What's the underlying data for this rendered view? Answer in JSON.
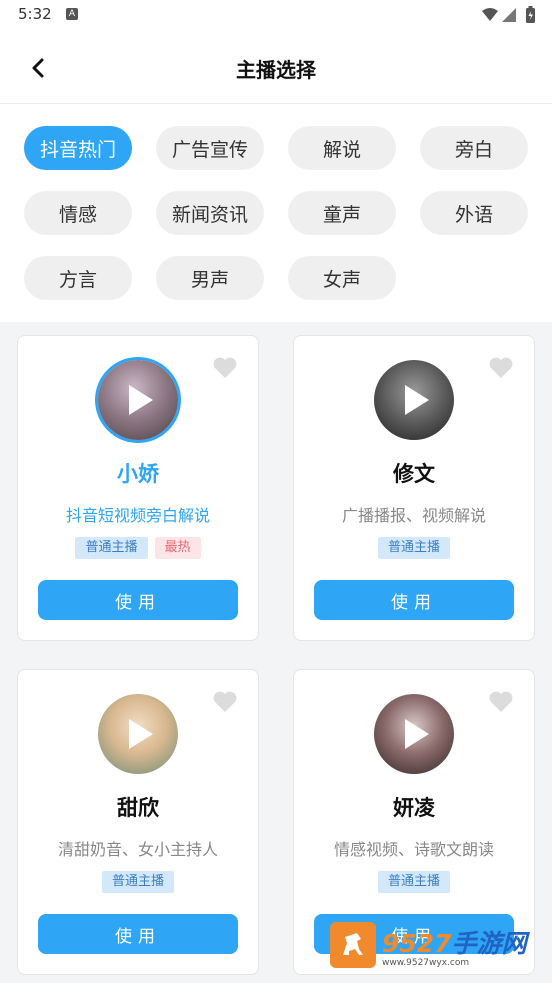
{
  "status_bar": {
    "time": "5:32",
    "indicator": "A"
  },
  "header": {
    "title": "主播选择",
    "back_icon": "chevron-left-icon"
  },
  "categories": [
    {
      "label": "抖音热门",
      "active": true
    },
    {
      "label": "广告宣传",
      "active": false
    },
    {
      "label": "解说",
      "active": false
    },
    {
      "label": "旁白",
      "active": false
    },
    {
      "label": "情感",
      "active": false
    },
    {
      "label": "新闻资讯",
      "active": false
    },
    {
      "label": "童声",
      "active": false
    },
    {
      "label": "外语",
      "active": false
    },
    {
      "label": "方言",
      "active": false
    },
    {
      "label": "男声",
      "active": false
    },
    {
      "label": "女声",
      "active": false
    }
  ],
  "anchors": [
    {
      "name": "小娇",
      "desc": "抖音短视频旁白解说",
      "tags": [
        "普通主播",
        "最热"
      ],
      "use_label": "使用",
      "selected": true
    },
    {
      "name": "修文",
      "desc": "广播播报、视频解说",
      "tags": [
        "普通主播"
      ],
      "use_label": "使用",
      "selected": false
    },
    {
      "name": "甜欣",
      "desc": "清甜奶音、女小主持人",
      "tags": [
        "普通主播"
      ],
      "use_label": "使用",
      "selected": false
    },
    {
      "name": "妍凌",
      "desc": "情感视频、诗歌文朗读",
      "tags": [
        "普通主播"
      ],
      "use_label": "使用",
      "selected": false
    }
  ],
  "watermark": {
    "title_orange": "9527",
    "title_blue": "手游网",
    "url": "www.9527wyx.com"
  },
  "colors": {
    "accent": "#2ea6f5",
    "tag_normal_bg": "#d4e8fb",
    "tag_hot_bg": "#fde5e7",
    "watermark_orange": "#f08a2c"
  }
}
